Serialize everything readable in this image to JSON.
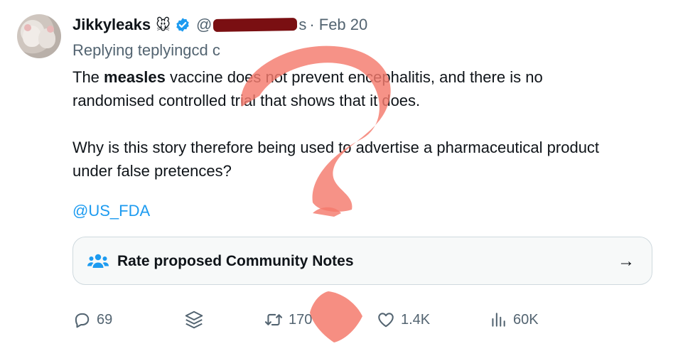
{
  "tweet": {
    "author_name": "Jikkyleaks",
    "author_emoji": "🐭",
    "handle_prefix": "@",
    "handle_suffix": "s",
    "date": "· Feb 20",
    "replying_to": "Replying teplyingcd c",
    "body_lead": "The ",
    "body_bold": "measles",
    "body_rest": " vaccine does not prevent encephalitis, and there is no randomised controlled trial that shows that it does.",
    "body_para2": "Why is this story therefore being used to advertise a pharmaceutical product under false pretences?",
    "mention": "@US_FDA"
  },
  "community_notes": {
    "label": "Rate proposed Community Notes",
    "arrow": "→"
  },
  "actions": {
    "replies": "69",
    "retweets": "170",
    "likes": "1.4K",
    "views": "60K"
  },
  "icons": {
    "verified": "verified-badge-icon",
    "reply": "reply-icon",
    "stack": "stack-layers-icon",
    "retweet": "retweet-icon",
    "like": "heart-icon",
    "views": "views-chart-icon",
    "notes": "people-icon"
  },
  "colors": {
    "text": "#0f1419",
    "muted": "#536471",
    "link": "#1d9bf0",
    "verified": "#1d9bf0",
    "overlay": "#f47a6c",
    "redaction": "#7a0f12"
  }
}
